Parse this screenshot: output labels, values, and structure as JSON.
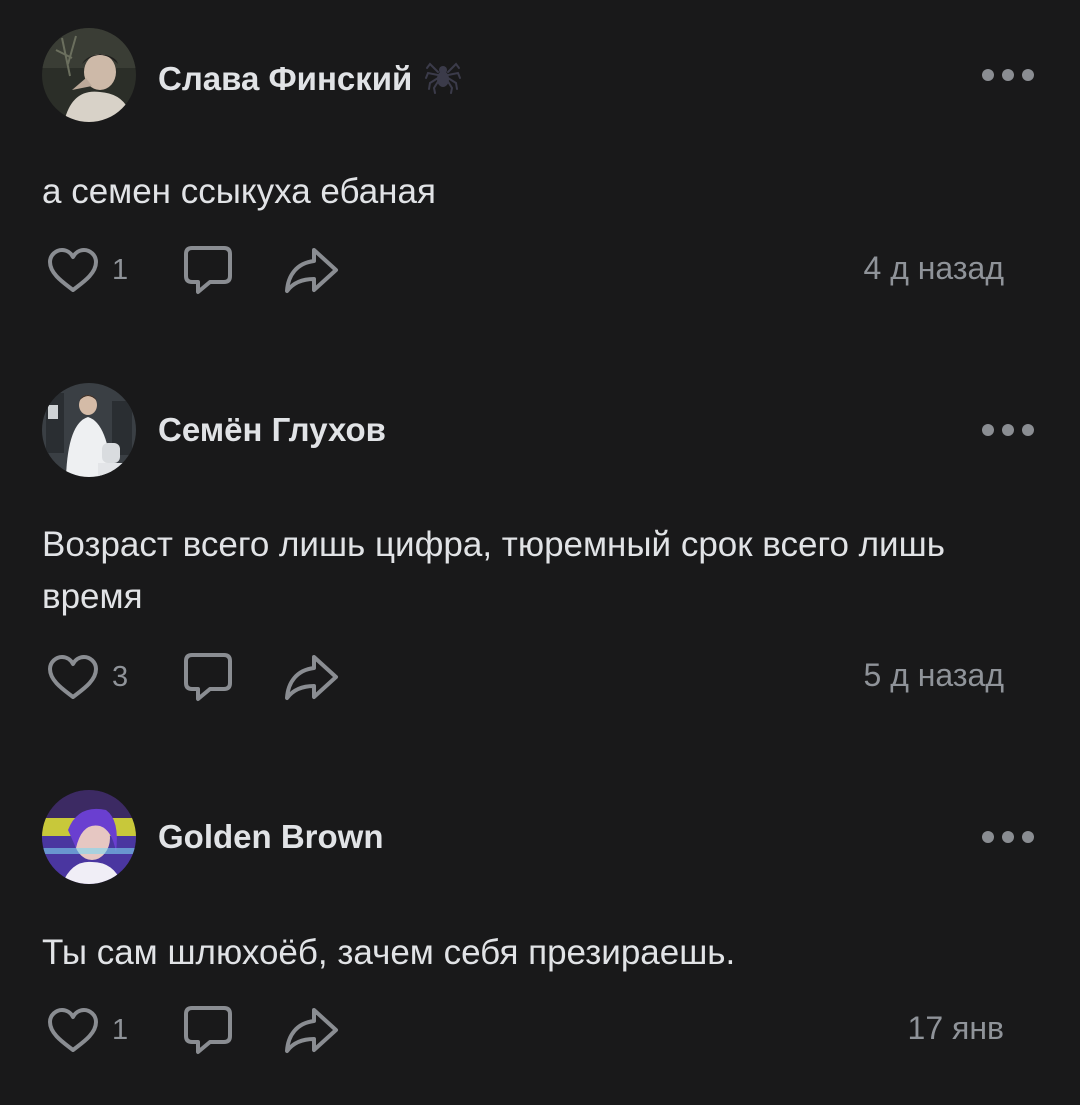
{
  "theme": {
    "background": "#19191a",
    "text": "#e1e3e6",
    "muted": "#8f9399",
    "icon": "#8a8d92"
  },
  "comments": [
    {
      "author": "Слава Финский",
      "badge_icon": "spider-icon",
      "text": "а семен ссыкуха ебаная",
      "likes": "1",
      "time": "4 д назад"
    },
    {
      "author": "Семён Глухов",
      "text": "Возраст всего лишь цифра, тюремный срок всего лишь время",
      "likes": "3",
      "time": "5 д назад"
    },
    {
      "author": "Golden Brown",
      "text": "Ты сам шлюхоёб, зачем себя презираешь.",
      "likes": "1",
      "time": "17 янв"
    }
  ],
  "icons": {
    "like": "heart-icon",
    "comment": "comment-bubble-icon",
    "share": "share-arrow-icon",
    "more": "more-dots-icon"
  }
}
